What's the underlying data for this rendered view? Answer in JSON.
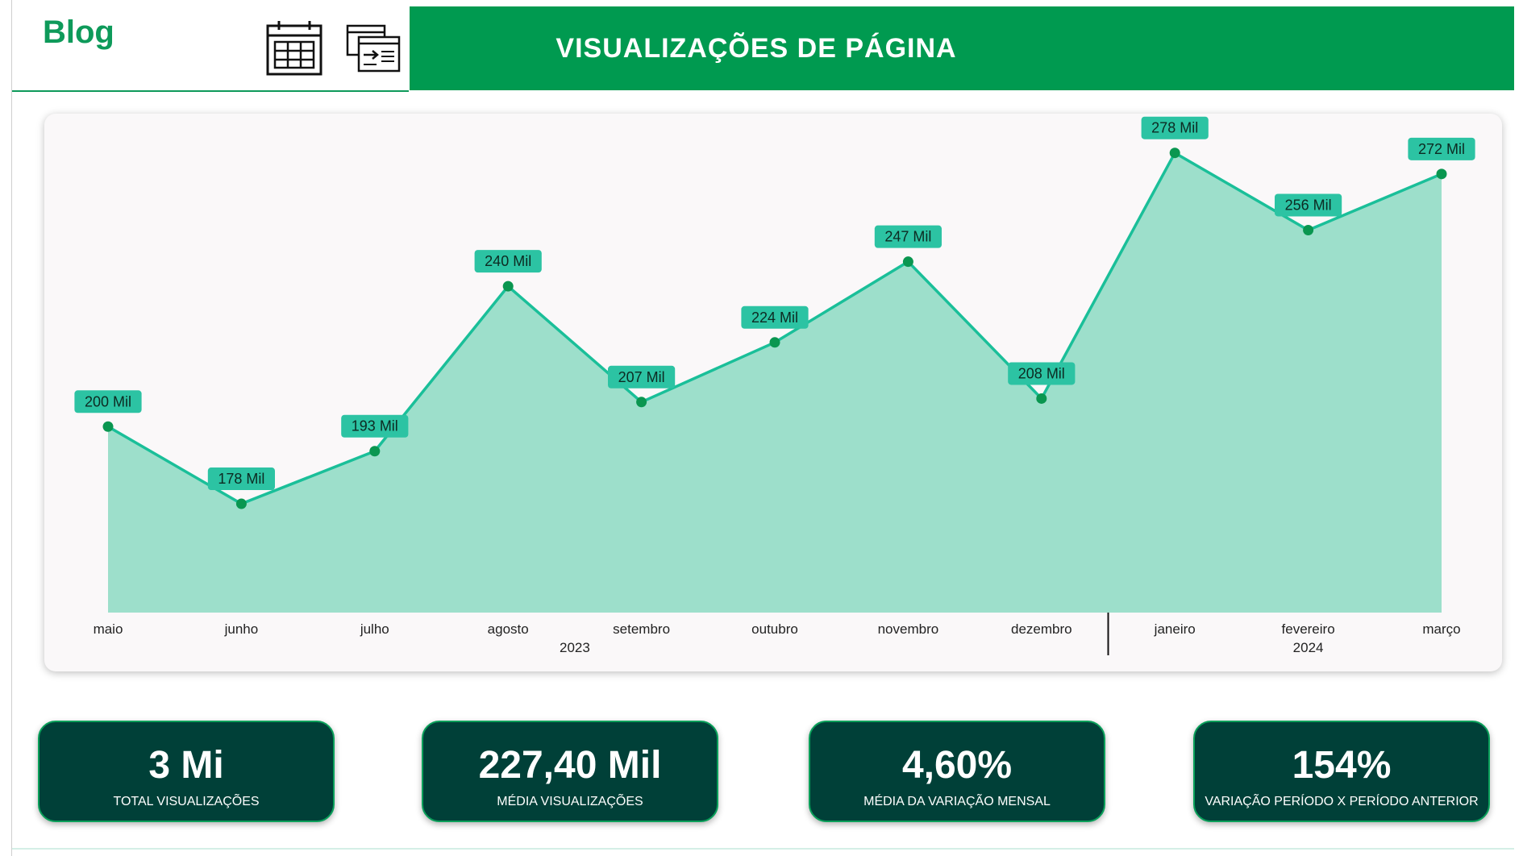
{
  "header": {
    "brand": "Blog",
    "title": "VISUALIZAÇÕES DE PÁGINA",
    "icons": [
      "calendar-icon",
      "report-export-icon"
    ],
    "colors": {
      "header_bg": "#009a50",
      "brand": "#0e9a5a"
    }
  },
  "chart_data": {
    "type": "area",
    "categories": [
      "maio",
      "junho",
      "julho",
      "agosto",
      "setembro",
      "outubro",
      "novembro",
      "dezembro",
      "janeiro",
      "fevereiro",
      "março"
    ],
    "year_groups": [
      {
        "label": "2023",
        "start": 0,
        "end": 7
      },
      {
        "label": "2024",
        "start": 8,
        "end": 10
      }
    ],
    "series": [
      {
        "values": [
          200,
          178,
          193,
          240,
          207,
          224,
          247,
          208,
          278,
          256,
          272
        ],
        "labels": [
          "200 Mil",
          "178 Mil",
          "193 Mil",
          "240 Mil",
          "207 Mil",
          "224 Mil",
          "247 Mil",
          "208 Mil",
          "278 Mil",
          "256 Mil",
          "272 Mil"
        ]
      }
    ],
    "unit": "Mil",
    "ylim": [
      147,
      280
    ],
    "grid": false,
    "legend": "none",
    "colors": {
      "line": "#1abf99",
      "fill": "#9ddfcb",
      "marker": "#0a9650",
      "label_bg": "#2cc3a3"
    }
  },
  "kpis": [
    {
      "value": "3 Mi",
      "label": "TOTAL VISUALIZAÇÕES"
    },
    {
      "value": "227,40 Mil",
      "label": "MÉDIA VISUALIZAÇÕES"
    },
    {
      "value": "4,60%",
      "label": "MÉDIA DA VARIAÇÃO MENSAL"
    },
    {
      "value": "154%",
      "label": "VARIAÇÃO PERÍODO X PERÍODO ANTERIOR"
    }
  ]
}
